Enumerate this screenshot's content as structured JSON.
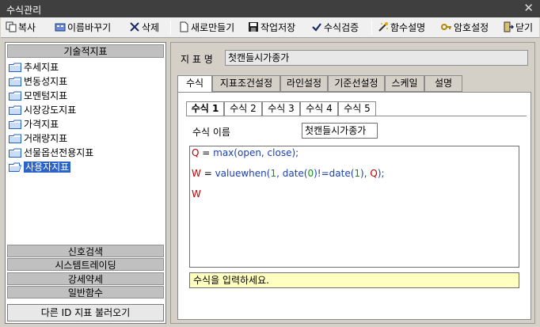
{
  "window": {
    "title": "수식관리",
    "close_glyph": "✕"
  },
  "toolbar": [
    {
      "id": "copy",
      "label": "복사",
      "icon": "copy-icon"
    },
    {
      "id": "rename",
      "label": "이름바꾸기",
      "icon": "rename-icon"
    },
    {
      "id": "delete",
      "label": "삭제",
      "icon": "delete-icon"
    },
    {
      "id": "new",
      "label": "새로만들기",
      "icon": "new-doc-icon"
    },
    {
      "id": "save",
      "label": "작업저장",
      "icon": "save-icon"
    },
    {
      "id": "verify",
      "label": "수식검증",
      "icon": "check-icon"
    },
    {
      "id": "func_help",
      "label": "함수설명",
      "icon": "wand-icon"
    },
    {
      "id": "password",
      "label": "암호설정",
      "icon": "key-icon"
    },
    {
      "id": "close",
      "label": "닫기",
      "icon": "exit-icon"
    }
  ],
  "sidebar": {
    "header": "기술적지표",
    "items": [
      {
        "label": "추세지표",
        "selected": false
      },
      {
        "label": "변동성지표",
        "selected": false
      },
      {
        "label": "모멘텀지표",
        "selected": false
      },
      {
        "label": "시장강도지표",
        "selected": false
      },
      {
        "label": "가격지표",
        "selected": false
      },
      {
        "label": "거래량지표",
        "selected": false
      },
      {
        "label": "선물옵션전용지표",
        "selected": false
      },
      {
        "label": "사용자지표",
        "selected": true
      }
    ],
    "categories": [
      "신호검색",
      "시스템트레이딩",
      "강세약세",
      "일반함수"
    ],
    "load_button": "다른 ID 지표 불러오기"
  },
  "main": {
    "indicator_name_label": "지 표 명",
    "indicator_name_value": "첫캔들시가종가",
    "tabs": [
      "수식",
      "지표조건설정",
      "라인설정",
      "기준선설정",
      "스케일",
      "설명"
    ],
    "active_tab": 0,
    "formula_tabs": [
      "수식 1",
      "수식 2",
      "수식 3",
      "수식 4",
      "수식 5"
    ],
    "active_formula_tab": 0,
    "formula_name_label": "수식 이름",
    "formula_name_value": "첫캔들시가종가",
    "code": {
      "line1": {
        "var": "Q",
        "op": " = ",
        "fn": "max",
        "rest": "(open, close);"
      },
      "line2": {
        "var": "W",
        "op": " = ",
        "fn": "valuewhen",
        "p1": "(",
        "n1": "1",
        "p2": ", ",
        "fn2": "date",
        "p3": "(",
        "n2": "0",
        "p4": ")!=",
        "fn3": "date",
        "p5": "(",
        "n3": "1",
        "p6": "), ",
        "v2": "Q",
        "p7": ");"
      },
      "line3": {
        "var": "W"
      }
    },
    "hint_text": "수식을 입력하세요."
  }
}
